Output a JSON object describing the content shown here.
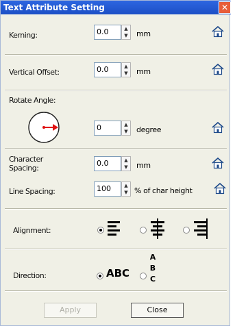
{
  "window": {
    "title": "Text Attribute Setting",
    "close_glyph": "✕"
  },
  "kerning": {
    "label": "Kerning:",
    "value": "0.0",
    "unit": "mm"
  },
  "vertical_offset": {
    "label": "Vertical Offset:",
    "value": "0.0",
    "unit": "mm"
  },
  "rotate_angle": {
    "label": "Rotate Angle:",
    "value": "0",
    "unit": "degree"
  },
  "character_spacing": {
    "label_line1": "Character",
    "label_line2": "Spacing:",
    "value": "0.0",
    "unit": "mm"
  },
  "line_spacing": {
    "label": "Line Spacing:",
    "value": "100",
    "unit": "% of char height"
  },
  "alignment": {
    "label": "Alignment:",
    "selected": "left",
    "options": [
      "left",
      "center",
      "right"
    ]
  },
  "direction": {
    "label": "Direction:",
    "horizontal_text": "ABC",
    "vertical_chars": [
      "A",
      "B",
      "C"
    ],
    "selected": "horizontal"
  },
  "buttons": {
    "apply": "Apply",
    "close": "Close"
  },
  "colors": {
    "titlebar": "#1c4fc6",
    "dial_arrow": "#e01010"
  },
  "icons": {
    "reset": "house-icon",
    "spin_up": "▲",
    "spin_down": "▼"
  }
}
